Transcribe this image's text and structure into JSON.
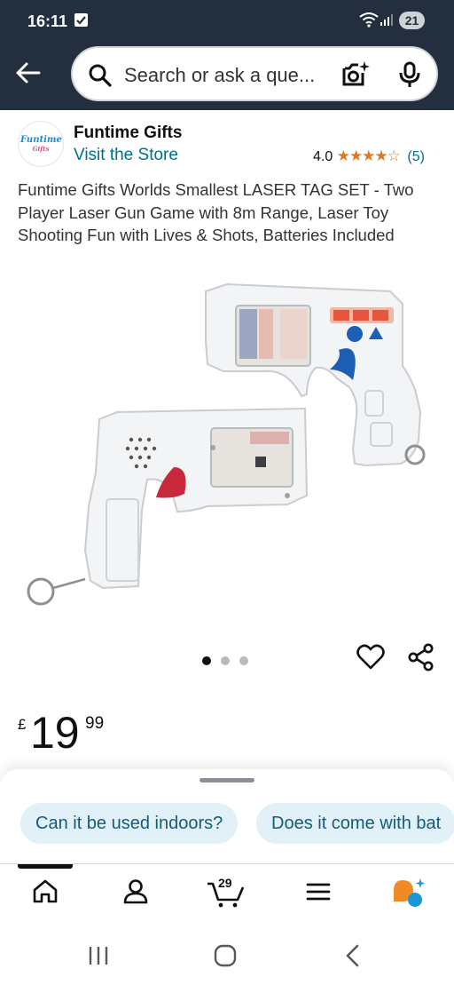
{
  "status_bar": {
    "time": "16:11",
    "battery": "21"
  },
  "search": {
    "placeholder": "Search or ask a que..."
  },
  "store": {
    "logo_text": "Funtime",
    "logo_sub": "Gifts",
    "name": "Funtime Gifts",
    "link": "Visit the Store",
    "rating_value": "4.0",
    "stars": "★★★★☆",
    "rating_count": "(5)"
  },
  "product": {
    "title": "Funtime Gifts Worlds Smallest LASER TAG SET - Two Player Laser Gun Game with 8m Range, Laser Toy Shooting Fun with Lives & Shots, Batteries Included",
    "image_alt": "Two white toy laser guns with keyrings",
    "carousel": {
      "total": 3,
      "active": 1
    },
    "price": {
      "currency": "£",
      "whole": "19",
      "fraction": "99"
    }
  },
  "suggested_questions": [
    "Can it be used indoors?",
    "Does it come with bat"
  ],
  "bottom_nav": {
    "items": [
      "home-icon",
      "account-icon",
      "cart-icon",
      "menu-icon",
      "rufus-icon"
    ],
    "cart_count": "29",
    "active": "home"
  },
  "system_nav": [
    "recents-icon",
    "home-button-icon",
    "back-icon"
  ],
  "colors": {
    "header_bg": "#232f3e",
    "link": "#007185",
    "star": "#de7921",
    "chip_bg": "#e2f1f7",
    "chip_text": "#155c7a",
    "rufus_orange": "#f08a24",
    "rufus_blue": "#1a98d5"
  }
}
